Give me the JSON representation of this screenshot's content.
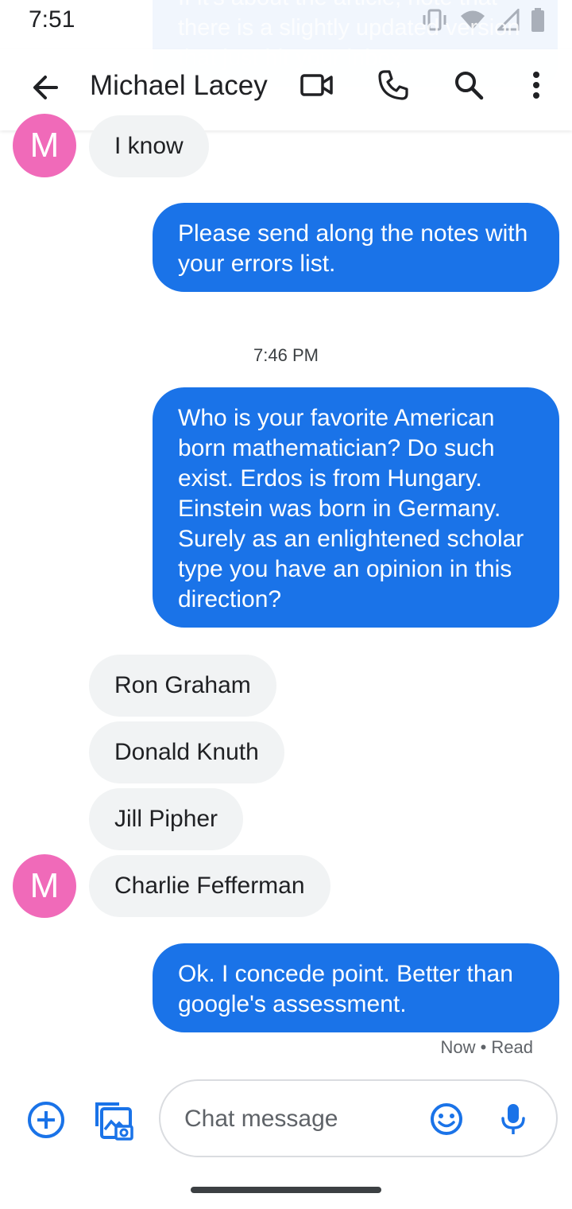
{
  "status_bar": {
    "time": "7:51",
    "icons": [
      "vibrate-icon",
      "wifi-icon",
      "signal-icon",
      "battery-icon"
    ]
  },
  "ghost": {
    "text": "If it's about the article, note that there is a slightly updated version that just hit your inbox."
  },
  "header": {
    "title": "Michael Lacey",
    "icons": [
      "back-arrow-icon",
      "video-call-icon",
      "phone-icon",
      "search-icon",
      "more-vert-icon"
    ]
  },
  "colors": {
    "outgoing_bubble": "#1a73e8",
    "incoming_bubble": "#f1f3f4",
    "avatar": "#f06ab9",
    "accent": "#1a73e8"
  },
  "conversation": {
    "avatar_initial": "M",
    "msg_1": "I know",
    "msg_2": "Please send along the notes with your errors list.",
    "timestamp": "7:46 PM",
    "msg_3": "Who is your favorite American born mathematician? Do such exist. Erdos is from Hungary. Einstein was born in Germany. Surely as an enlightened scholar type you have an opinion in this direction?",
    "msg_4": "Ron Graham",
    "msg_5": "Donald Knuth",
    "msg_6": "Jill Pipher",
    "msg_7": "Charlie Fefferman",
    "msg_8": "Ok. I concede point. Better than google's assessment.",
    "receipt": "Now • Read"
  },
  "compose": {
    "placeholder": "Chat message",
    "icons": [
      "add-circle-icon",
      "gallery-icon",
      "emoji-icon",
      "mic-icon"
    ]
  }
}
